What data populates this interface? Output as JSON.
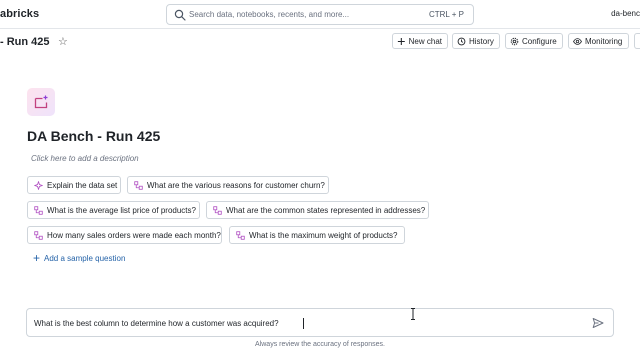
{
  "topbar": {
    "brand": "abricks",
    "search_placeholder": "Search data, notebooks, recents, and more...",
    "search_shortcut": "CTRL + P",
    "user_label": "da-benc"
  },
  "header": {
    "title": "- Run 425",
    "buttons": {
      "new_chat": "New chat",
      "history": "History",
      "configure": "Configure",
      "monitoring": "Monitoring"
    }
  },
  "space": {
    "title": "DA Bench - Run 425",
    "description_placeholder": "Click here to add a description",
    "sample_questions": [
      "Explain the data set",
      "What are the various reasons for customer churn?",
      "What is the average list price of products?",
      "What are the common states represented in addresses?",
      "How many sales orders were made each month?",
      "What is the maximum weight of products?"
    ],
    "add_sample_label": "Add a sample question"
  },
  "chat": {
    "input_value": "What is the best column to determine how a customer was acquired?",
    "footnote": "Always review the accuracy of responses."
  },
  "colors": {
    "accent_link": "#2563a8",
    "chip_icon": "#b04fc2",
    "border": "#cfd5db"
  }
}
